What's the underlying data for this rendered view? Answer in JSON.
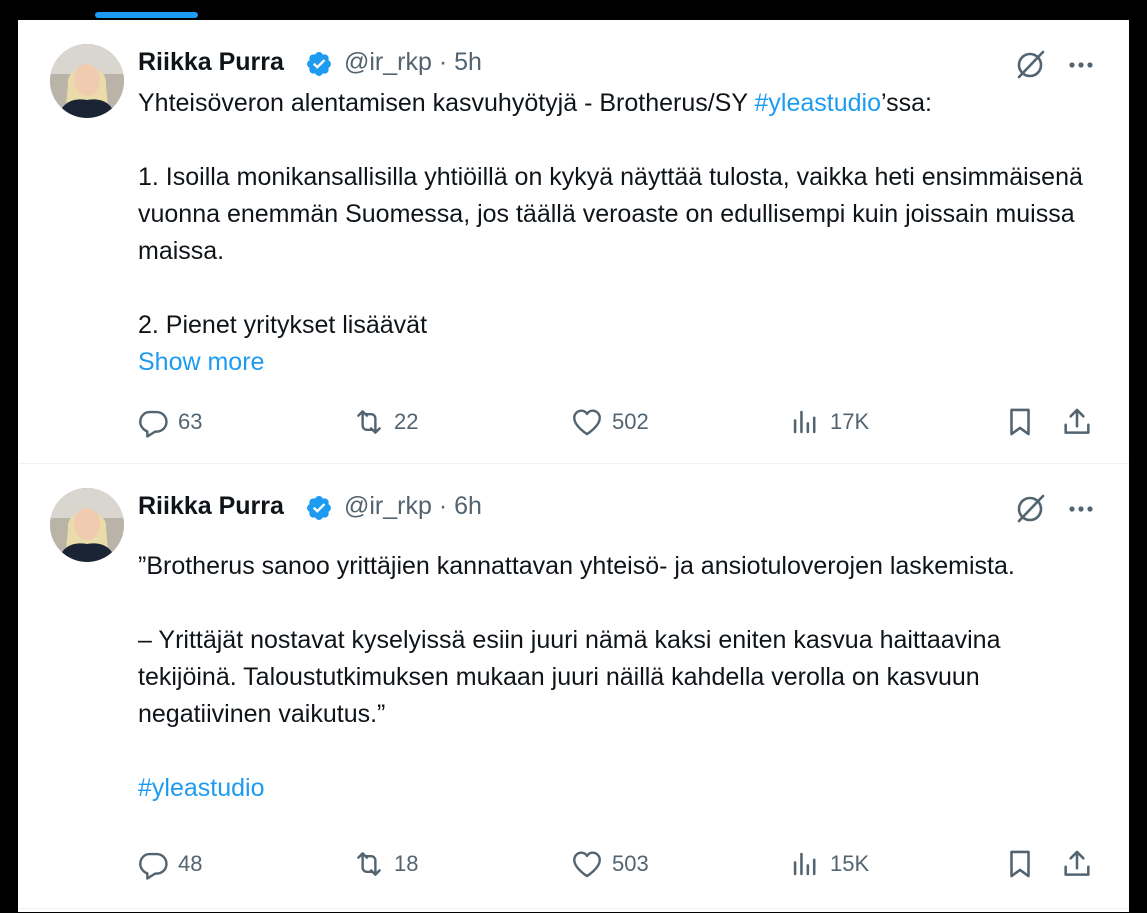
{
  "colors": {
    "accent": "#1d9bf0",
    "text": "#0f1419",
    "muted": "#536471",
    "verified": "#1d9bf0"
  },
  "tweets": [
    {
      "name": "Riikka Purra",
      "handle": "@ir_rkp",
      "sep": "·",
      "time": "5h",
      "line1_pre": "Yhteisöveron alentamisen kasvuhyötyjä - Brotherus/SY ",
      "line1_hashtag": "#yleastudio",
      "line1_post": "’ssa:",
      "para1": "1. Isoilla monikansallisilla yhtiöillä on kykyä näyttää tulosta, vaikka heti ensimmäisenä vuonna enemmän Suomessa, jos täällä veroaste on edullisempi kuin joissain muissa maissa.",
      "para2": "2. Pienet yritykset lisäävät",
      "show_more": "Show more",
      "replies": "63",
      "reposts": "22",
      "likes": "502",
      "views": "17K"
    },
    {
      "name": "Riikka Purra",
      "handle": "@ir_rkp",
      "sep": "·",
      "time": "6h",
      "para1": "”Brotherus sanoo yrittäjien kannattavan yhteisö- ja ansiotuloverojen laskemista.",
      "para2": "– Yrittäjät nostavat kyselyissä esiin juuri nämä kaksi eniten kasvua haittaavina tekijöinä. Taloustutkimuksen mukaan juuri näillä kahdella verolla on kasvuun negatiivinen vaikutus.”",
      "hashtag": "#yleastudio",
      "replies": "48",
      "reposts": "18",
      "likes": "503",
      "views": "15K"
    }
  ],
  "icons": {
    "reply": "reply-icon",
    "repost": "repost-icon",
    "like": "heart-icon",
    "views": "views-icon",
    "bookmark": "bookmark-icon",
    "share": "share-icon",
    "grok": "grok-icon",
    "more": "more-icon",
    "verified": "verified-badge-icon"
  }
}
